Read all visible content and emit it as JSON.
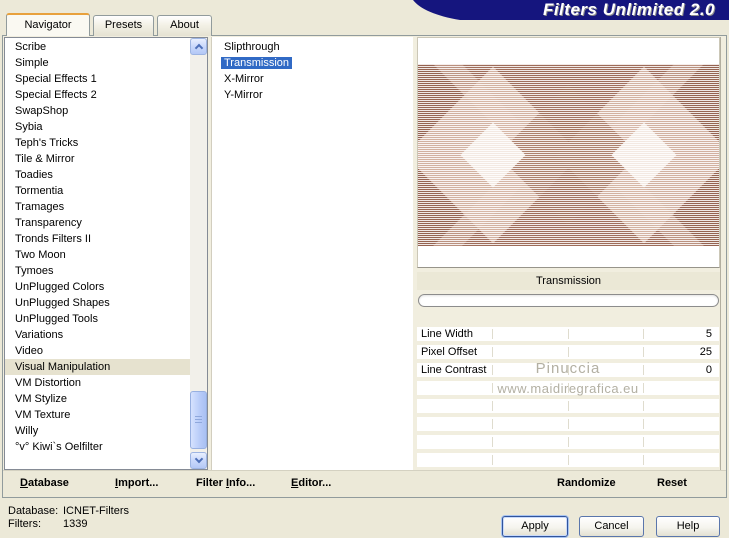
{
  "banner": {
    "title": "Filters Unlimited 2.0"
  },
  "tabs": [
    {
      "label": "Navigator",
      "active": true
    },
    {
      "label": "Presets",
      "active": false
    },
    {
      "label": "About",
      "active": false
    }
  ],
  "category_list": {
    "items": [
      "Scribe",
      "Simple",
      "Special Effects 1",
      "Special Effects 2",
      "SwapShop",
      "Sybia",
      "Teph's Tricks",
      "Tile & Mirror",
      "Toadies",
      "Tormentia",
      "Tramages",
      "Transparency",
      "Tronds Filters II",
      "Two Moon",
      "Tymoes",
      "UnPlugged Colors",
      "UnPlugged Shapes",
      "UnPlugged Tools",
      "Variations",
      "Video",
      "Visual Manipulation",
      "VM Distortion",
      "VM Stylize",
      "VM Texture",
      "Willy",
      "°v° Kiwi`s Oelfilter"
    ],
    "selected": "Visual Manipulation"
  },
  "filter_list": {
    "items": [
      "Slipthrough",
      "Transmission",
      "X-Mirror",
      "Y-Mirror"
    ],
    "selected": "Transmission"
  },
  "preview": {
    "caption": "Transmission"
  },
  "parameters": [
    {
      "label": "Line Width",
      "value": "5"
    },
    {
      "label": "Pixel Offset",
      "value": "25"
    },
    {
      "label": "Line Contrast",
      "value": "0"
    }
  ],
  "watermark": {
    "line1": "Pinuccia",
    "line2": "www.maidiregrafica.eu"
  },
  "command_bar": {
    "database": {
      "label": "Database",
      "accel": 0
    },
    "import": {
      "label": "Import...",
      "accel": 0
    },
    "filter_info": {
      "label": "Filter Info...",
      "accel": 7
    },
    "editor": {
      "label": "Editor...",
      "accel": 0
    },
    "randomize": {
      "label": "Randomize",
      "accel": -1
    },
    "reset": {
      "label": "Reset",
      "accel": -1
    }
  },
  "status": {
    "database_label": "Database:",
    "database_value": "ICNET-Filters",
    "filters_label": "Filters:",
    "filters_value": "1339"
  },
  "dialog_buttons": {
    "apply": "Apply",
    "cancel": "Cancel",
    "help": "Help"
  },
  "icons": {
    "scroll_up": "chevron-up",
    "scroll_down": "chevron-down"
  },
  "colors": {
    "dialog_bg": "#ECE9D8",
    "banner_bg": "#15157E",
    "selection_blue": "#316AC5",
    "inactive_selection": "#E6E2CF",
    "tab_accent_orange": "#E8A13C",
    "pattern_brown_dark": "#8E5A48",
    "pattern_brown_light": "#D8B9A9"
  }
}
